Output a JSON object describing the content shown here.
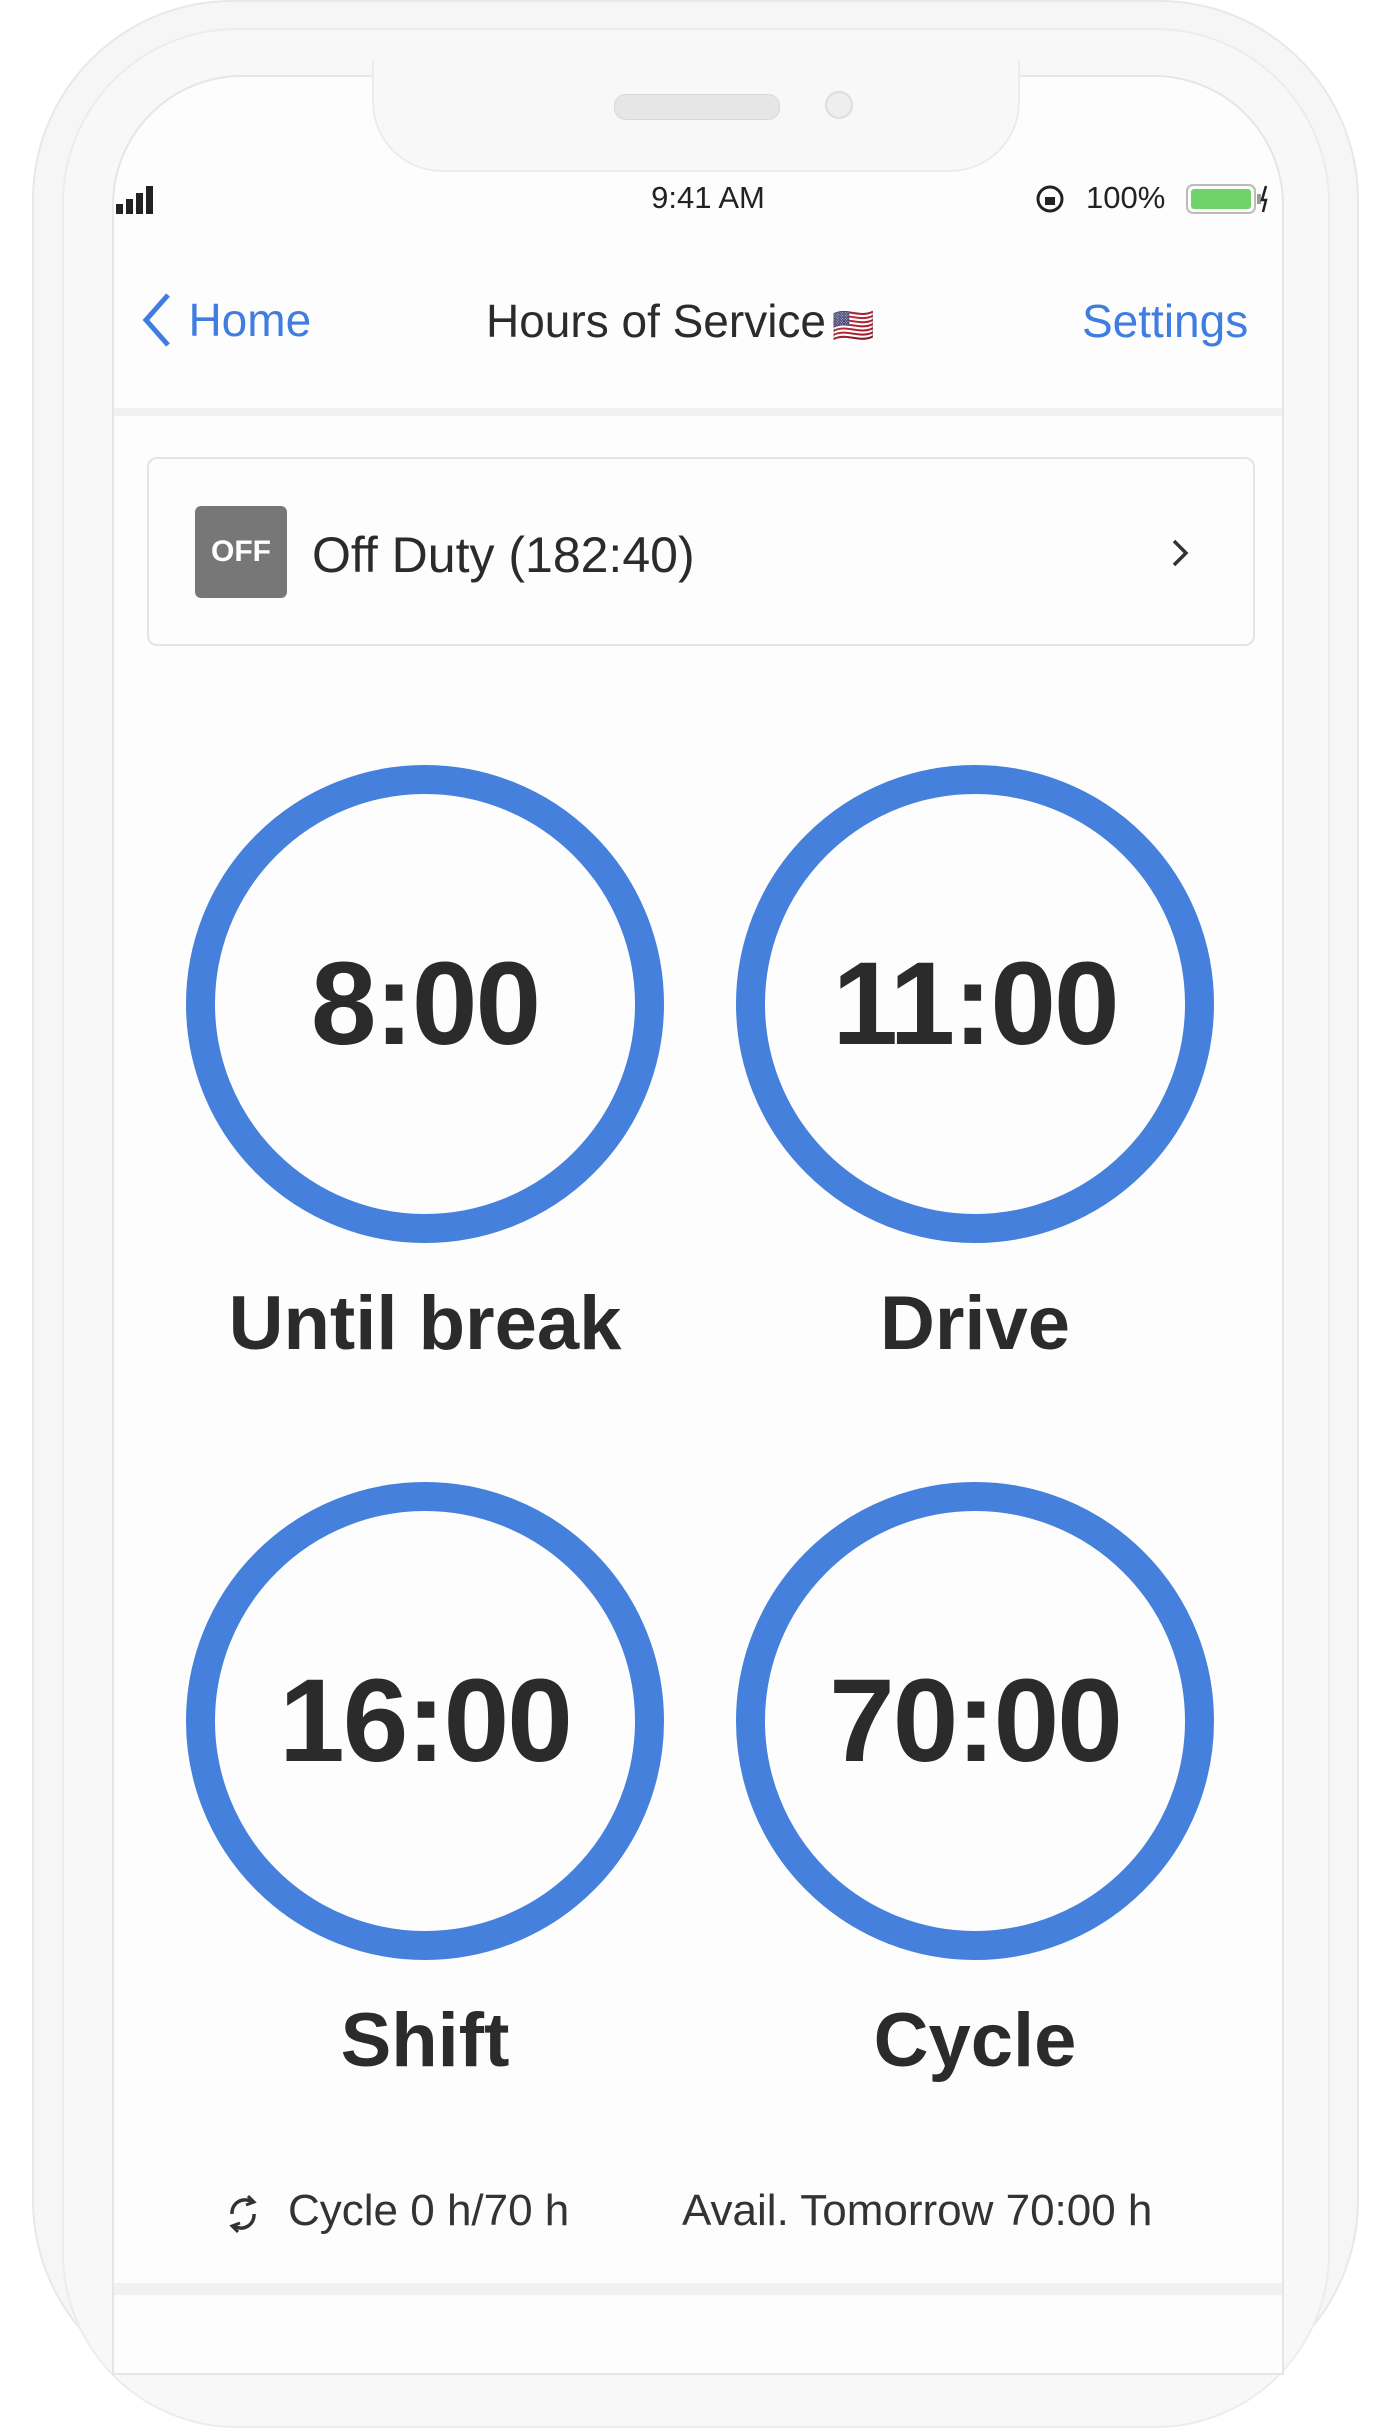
{
  "status_bar": {
    "time": "9:41 AM",
    "battery": "100%",
    "battery_color": "#6fd36a"
  },
  "nav": {
    "back_label": "Home",
    "title": "Hours of Service",
    "flag": "🇺🇸",
    "settings_label": "Settings",
    "accent": "#3f7de0"
  },
  "duty_status": {
    "badge": "OFF",
    "label": "Off Duty (182:40)"
  },
  "timers": [
    {
      "value": "8:00",
      "label": "Until break"
    },
    {
      "value": "11:00",
      "label": "Drive"
    },
    {
      "value": "16:00",
      "label": "Shift"
    },
    {
      "value": "70:00",
      "label": "Cycle"
    }
  ],
  "ring_color": "#4580dc",
  "footer": {
    "cycle": "Cycle 0 h/70 h",
    "available": "Avail. Tomorrow 70:00 h"
  }
}
